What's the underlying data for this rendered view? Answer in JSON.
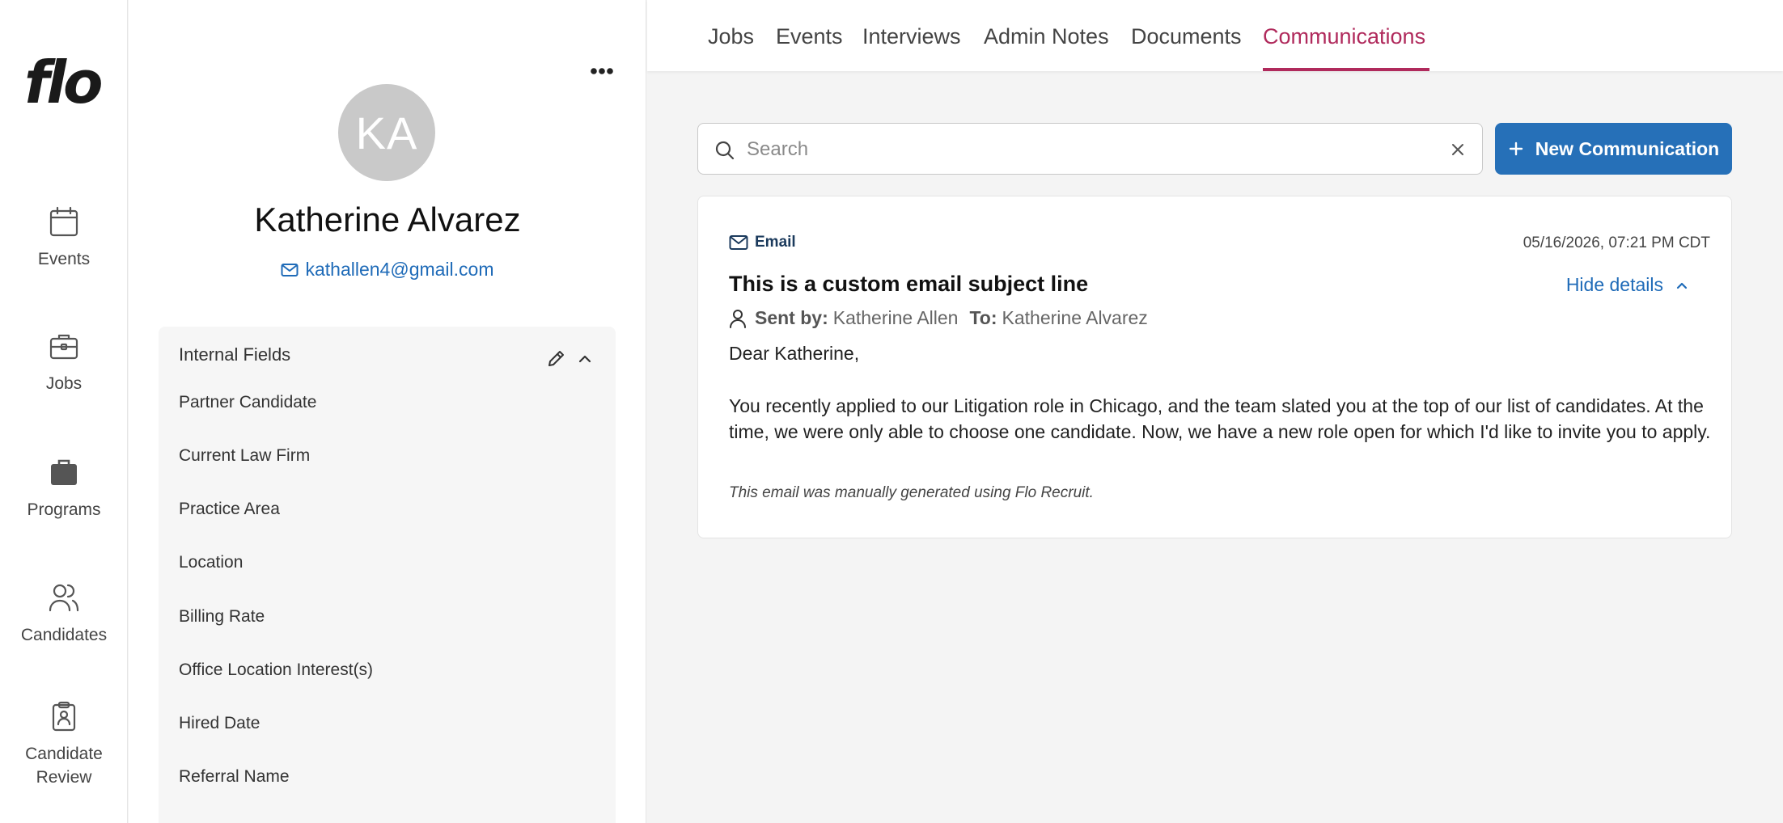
{
  "nav": {
    "logo": "flo",
    "items": [
      {
        "label": "Events",
        "icon": "calendar-icon"
      },
      {
        "label": "Jobs",
        "icon": "briefcase-icon"
      },
      {
        "label": "Programs",
        "icon": "briefcase-filled-icon"
      },
      {
        "label": "Candidates",
        "icon": "users-icon"
      },
      {
        "label": "Candidate Review",
        "icon": "clipboard-user-icon"
      }
    ]
  },
  "profile": {
    "initials": "KA",
    "name": "Katherine Alvarez",
    "email": "kathallen4@gmail.com",
    "internal_fields": {
      "title": "Internal Fields",
      "items": [
        "Partner Candidate",
        "Current Law Firm",
        "Practice Area",
        "Location",
        "Billing Rate",
        "Office Location Interest(s)",
        "Hired Date",
        "Referral Name"
      ]
    }
  },
  "tabs": {
    "items": [
      "Jobs",
      "Events",
      "Interviews",
      "Admin Notes",
      "Documents",
      "Communications"
    ],
    "active": "Communications"
  },
  "search": {
    "placeholder": "Search",
    "value": ""
  },
  "new_communication_label": "New Communication",
  "communication": {
    "type": "Email",
    "datetime": "05/16/2026, 07:21 PM CDT",
    "subject": "This is a custom email subject line",
    "hide_details_label": "Hide details",
    "sent_by_label": "Sent by:",
    "sent_by": "Katherine Allen",
    "to_label": "To:",
    "to": "Katherine Alvarez",
    "greeting": "Dear Katherine,",
    "body": "You recently applied to our Litigation role in Chicago, and the team slated you at the top of our list of candidates. At the time, we were only able to choose one candidate. Now, we have a new role open for which I'd like to invite you to apply.",
    "footer": "This email was manually generated using Flo Recruit."
  },
  "colors": {
    "accent": "#b02a5c",
    "primary": "#2670b8",
    "link": "#1f6bb8"
  }
}
